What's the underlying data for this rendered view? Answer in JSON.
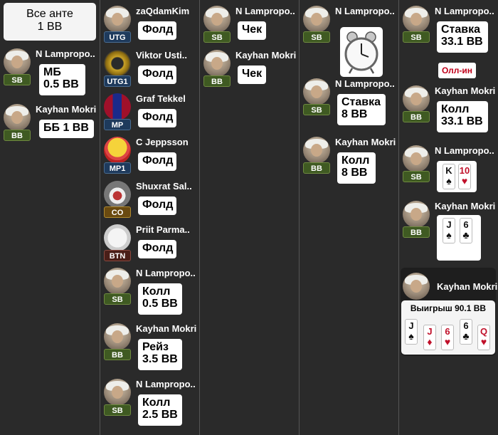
{
  "ante": {
    "line1": "Все анте",
    "line2": "1 BB"
  },
  "col1": [
    {
      "name": "N Lampropo..",
      "pos": "SB",
      "action": "МБ\n0.5 BB"
    },
    {
      "name": "Kayhan Mokri",
      "pos": "BB",
      "action": "ББ 1 BB"
    }
  ],
  "col2": [
    {
      "name": "zaQdamKim",
      "pos": "UTG",
      "action": "Фолд"
    },
    {
      "name": "Viktor Usti..",
      "pos": "UTG1",
      "action": "Фолд"
    },
    {
      "name": "Graf Tekkel",
      "pos": "MP",
      "action": "Фолд"
    },
    {
      "name": "C Jeppsson",
      "pos": "MP1",
      "action": "Фолд"
    },
    {
      "name": "Shuxrat Sal..",
      "pos": "CO",
      "action": "Фолд"
    },
    {
      "name": "Priit Parma..",
      "pos": "BTN",
      "action": "Фолд"
    },
    {
      "name": "N Lampropo..",
      "pos": "SB",
      "action": "Колл\n0.5 BB"
    },
    {
      "name": "Kayhan Mokri",
      "pos": "BB",
      "action": "Рейз\n3.5 BB"
    },
    {
      "name": "N Lampropo..",
      "pos": "SB",
      "action": "Колл\n2.5 BB"
    }
  ],
  "col3": [
    {
      "name": "N Lampropo..",
      "pos": "SB",
      "action": "Чек"
    },
    {
      "name": "Kayhan Mokri",
      "pos": "BB",
      "action": "Чек"
    }
  ],
  "col4": [
    {
      "name": "N Lampropo..",
      "pos": "SB"
    },
    {
      "name": "N Lampropo..",
      "pos": "SB",
      "action": "Ставка\n8 BB"
    },
    {
      "name": "Kayhan Mokri",
      "pos": "BB",
      "action": "Колл\n8 BB"
    }
  ],
  "col5": [
    {
      "name": "N Lampropo..",
      "pos": "SB",
      "action": "Ставка\n33.1 BB"
    },
    {
      "name": "Kayhan Mokri",
      "pos": "BB",
      "action": "Колл\n33.1 BB"
    },
    {
      "name": "N Lampropo..",
      "pos": "SB"
    },
    {
      "name": "Kayhan Mokri",
      "pos": "BB"
    }
  ],
  "allin_label": "Олл-ин",
  "showdown": {
    "sb_cards": [
      {
        "rank": "K",
        "suit": "♠",
        "color": "black"
      },
      {
        "rank": "10",
        "suit": "♥",
        "color": "red"
      }
    ],
    "bb_cards": [
      {
        "rank": "J",
        "suit": "♠",
        "color": "black"
      },
      {
        "rank": "6",
        "suit": "♣",
        "color": "black"
      }
    ]
  },
  "winner": {
    "name": "Kayhan Mokri",
    "text": "Выигрыш 90.1 BB",
    "cards": [
      {
        "rank": "J",
        "suit": "♠",
        "color": "black"
      },
      {
        "rank": "J",
        "suit": "♦",
        "color": "red"
      },
      {
        "rank": "6",
        "suit": "♥",
        "color": "red"
      },
      {
        "rank": "6",
        "suit": "♣",
        "color": "black"
      },
      {
        "rank": "Q",
        "suit": "♥",
        "color": "red"
      }
    ]
  },
  "colors": {
    "background": "#2a2a2a",
    "allin": "#c0001a"
  }
}
